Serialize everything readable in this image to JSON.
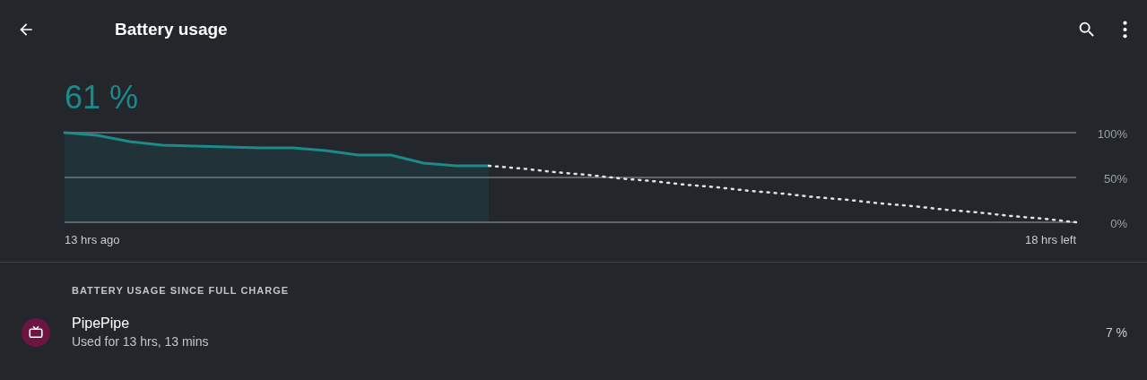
{
  "toolbar": {
    "title": "Battery usage"
  },
  "summary": {
    "percent": "61 %"
  },
  "chart": {
    "start_label": "13 hrs ago",
    "end_label": "18 hrs left",
    "chart_data": {
      "type": "area",
      "categories": [
        null,
        null,
        null,
        null,
        null,
        null,
        null,
        null,
        null,
        null,
        null,
        null,
        null,
        null,
        null,
        null,
        null,
        null,
        null,
        null,
        null,
        null,
        null,
        null,
        null,
        null,
        null,
        null,
        null,
        null,
        null,
        null
      ],
      "ylim": [
        0,
        100
      ],
      "yticks": [
        {
          "value": 0,
          "label": "0%"
        },
        {
          "value": 50,
          "label": "50%"
        },
        {
          "value": 100,
          "label": "100%"
        }
      ],
      "series": [
        {
          "color": "#1b8a8a",
          "type": "area",
          "line_style": "solid",
          "values": [
            100,
            97,
            90,
            86,
            85,
            84,
            83,
            83,
            80,
            75,
            75,
            66,
            63,
            63,
            null,
            null,
            null,
            null,
            null,
            null,
            null,
            null,
            null,
            null,
            null,
            null,
            null,
            null,
            null,
            null,
            null,
            null
          ]
        },
        {
          "color": "#dfe3e6",
          "type": "line",
          "line_style": "dotted",
          "values": [
            null,
            null,
            null,
            null,
            null,
            null,
            null,
            null,
            null,
            null,
            null,
            null,
            null,
            63,
            60,
            56,
            53,
            49,
            46,
            42,
            39,
            35,
            32,
            28,
            25,
            21,
            18,
            14,
            11,
            7,
            4,
            0
          ]
        }
      ]
    }
  },
  "section": {
    "header": "BATTERY USAGE SINCE FULL CHARGE"
  },
  "apps": [
    {
      "name": "PipePipe",
      "detail": "Used for 13 hrs, 13 mins",
      "percent": "7 %",
      "color": "#6e1440"
    }
  ]
}
